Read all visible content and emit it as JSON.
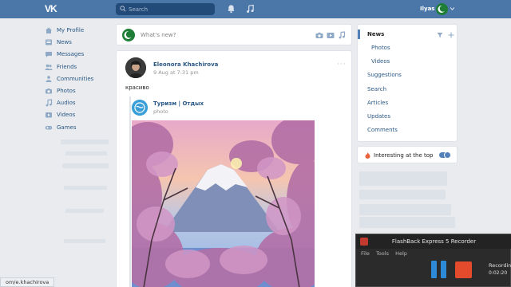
{
  "topbar": {
    "logo": "VK",
    "search_placeholder": "Search",
    "username": "Ilyas"
  },
  "sidebar": {
    "items": [
      {
        "label": "My Profile",
        "icon": "home-icon"
      },
      {
        "label": "News",
        "icon": "news-icon"
      },
      {
        "label": "Messages",
        "icon": "messages-icon"
      },
      {
        "label": "Friends",
        "icon": "friends-icon"
      },
      {
        "label": "Communities",
        "icon": "communities-icon"
      },
      {
        "label": "Photos",
        "icon": "camera-icon"
      },
      {
        "label": "Audios",
        "icon": "music-icon"
      },
      {
        "label": "Videos",
        "icon": "video-icon"
      },
      {
        "label": "Games",
        "icon": "gamepad-icon"
      }
    ]
  },
  "composer": {
    "placeholder": "What's new?"
  },
  "post": {
    "author": "Eleonora Khachirova",
    "date": "9 Aug at 7:31 pm",
    "text": "красиво",
    "repost": {
      "name": "Туризм | Отдых",
      "subtitle": "photo"
    }
  },
  "right_menu": {
    "items": [
      {
        "label": "News",
        "active": true
      },
      {
        "label": "Photos"
      },
      {
        "label": "Videos"
      },
      {
        "label": "Suggestions"
      },
      {
        "label": "Search"
      },
      {
        "label": "Articles"
      },
      {
        "label": "Updates"
      },
      {
        "label": "Comments"
      }
    ],
    "interesting_label": "Interesting at the top",
    "interesting_on": true
  },
  "statusbar": {
    "url": "om/e.khachirova"
  },
  "flashback": {
    "title": "FlashBack Express 5 Recorder",
    "menu": [
      "File",
      "Tools",
      "Help"
    ],
    "recording_label": "Recordings",
    "time": "0:02:20"
  },
  "colors": {
    "topbar": "#4a76a8",
    "link": "#2a5885",
    "accent": "#5181b8",
    "stop": "#e44a2c",
    "pause": "#2c8ad8"
  }
}
